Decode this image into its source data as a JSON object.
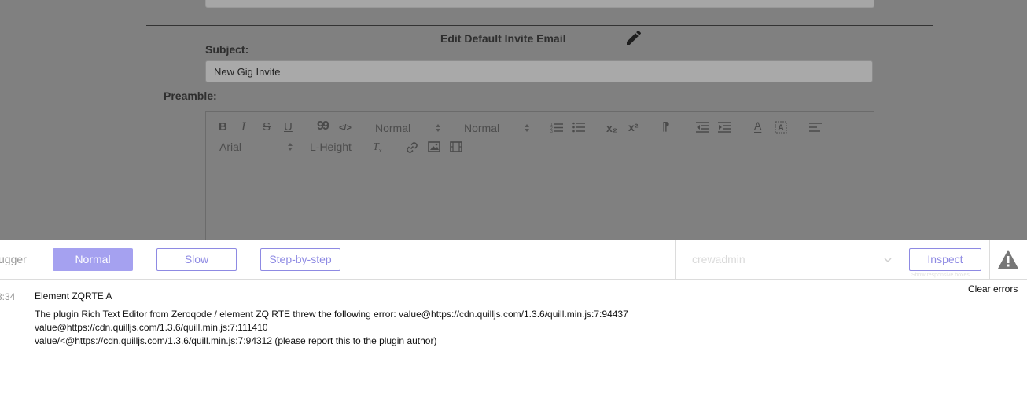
{
  "editor": {
    "title": "Edit Default Invite Email",
    "subject_label": "Subject:",
    "subject_value": "New Gig Invite",
    "preamble_label": "Preamble:",
    "toolbar": {
      "header_select": "Normal",
      "size_select": "Normal",
      "font_select": "Arial",
      "line_height_label": "L-Height",
      "bold": "B",
      "italic": "I",
      "strike": "S",
      "underline": "U",
      "quote": "99",
      "code": "</>",
      "subscript": "x₂",
      "superscript": "x²",
      "rtl": "⁋",
      "text_color": "A",
      "icons": [
        "bold-icon",
        "italic-icon",
        "strike-icon",
        "underline-icon",
        "blockquote-icon",
        "code-block-icon",
        "ordered-list-icon",
        "bullet-list-icon",
        "subscript-icon",
        "superscript-icon",
        "rtl-icon",
        "outdent-icon",
        "indent-icon",
        "text-color-icon",
        "background-color-icon",
        "align-icon",
        "clean-format-icon",
        "link-icon",
        "image-icon",
        "video-icon"
      ]
    }
  },
  "debugger": {
    "label": "ugger",
    "modes": {
      "normal": "Normal",
      "slow": "Slow",
      "step": "Step-by-step"
    },
    "active_mode": "normal",
    "user": "crewadmin",
    "inspect_label": "Inspect",
    "inspect_hint": "Show responsive boxes",
    "accent_color": "#8e8ae3",
    "active_color": "#a5a1f0"
  },
  "errors": {
    "clear_label": "Clear errors",
    "items": [
      {
        "time": "3:34",
        "element": "Element ZQRTE A",
        "lines": [
          "The plugin Rich Text Editor from Zeroqode / element ZQ RTE threw the following error: value@https://cdn.quilljs.com/1.3.6/quill.min.js:7:94437",
          "value@https://cdn.quilljs.com/1.3.6/quill.min.js:7:111410",
          "value/<@https://cdn.quilljs.com/1.3.6/quill.min.js:7:94312 (please report this to the plugin author)"
        ]
      }
    ]
  }
}
